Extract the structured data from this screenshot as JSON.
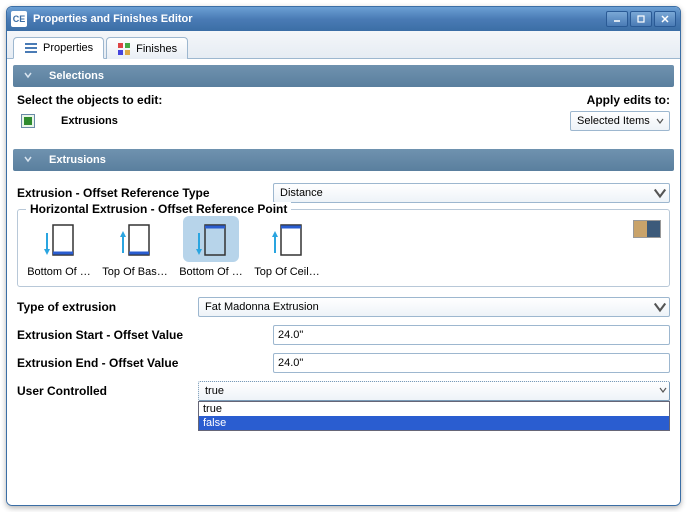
{
  "window": {
    "app_icon": "CE",
    "title": "Properties and Finishes Editor"
  },
  "tabs": {
    "properties": "Properties",
    "finishes": "Finishes"
  },
  "sections": {
    "selections": "Selections",
    "extrusions": "Extrusions"
  },
  "select_prompt": "Select the objects to edit:",
  "apply_prompt": "Apply edits to:",
  "object_type": "Extrusions",
  "apply_dropdown": "Selected Items",
  "fields": {
    "offset_type_label": "Extrusion - Offset Reference Type",
    "offset_type_value": "Distance",
    "ref_point_legend": "Horizontal Extrusion - Offset Reference Point",
    "type_label": "Type of extrusion",
    "type_value": "Fat Madonna Extrusion",
    "start_label": "Extrusion Start - Offset Value",
    "start_value": "24.0\"",
    "end_label": "Extrusion End - Offset Value",
    "end_value": "24.0\"",
    "user_label": "User Controlled",
    "user_value": "true"
  },
  "ref_points": {
    "r1": "Bottom Of …",
    "r2": "Top Of Bas…",
    "r3": "Bottom Of …",
    "r4": "Top Of Ceil…"
  },
  "dropdown_options": {
    "o1": "true",
    "o2": "false"
  }
}
